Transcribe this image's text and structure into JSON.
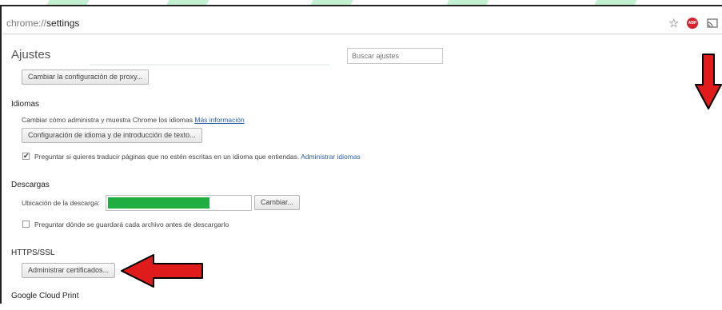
{
  "browser": {
    "url_scheme": "chrome://",
    "url_path": "settings",
    "icons": [
      "star-icon",
      "adblock-icon",
      "cast-icon"
    ],
    "adblock_text": "ABP"
  },
  "settings": {
    "title": "Ajustes",
    "search_placeholder": "Buscar ajustes",
    "proxy_button": "Cambiar la configuración de proxy...",
    "languages": {
      "title": "Idiomas",
      "description": "Cambiar cómo administra y muestra Chrome los idiomas",
      "more_info_link": "Más información",
      "config_button": "Configuración de idioma y de introducción de texto...",
      "translate_checkbox_label": "Preguntar si quieres traducir páginas que no estén escritas en un idioma que entiendas.",
      "translate_checked": true,
      "manage_link": "Administrar idiomas"
    },
    "downloads": {
      "title": "Descargas",
      "location_label": "Ubicación de la descarga:",
      "change_button": "Cambiar...",
      "ask_checkbox_label": "Preguntar dónde se guardará cada archivo antes de descargarlo",
      "ask_checked": false
    },
    "https": {
      "title": "HTTPS/SSL",
      "certificates_button": "Administrar certificados..."
    },
    "cloud_print": {
      "title": "Google Cloud Print"
    }
  },
  "colors": {
    "annotation_arrow": "#e01b1b",
    "download_redaction": "#1fae3f",
    "link": "#2a5db0"
  }
}
